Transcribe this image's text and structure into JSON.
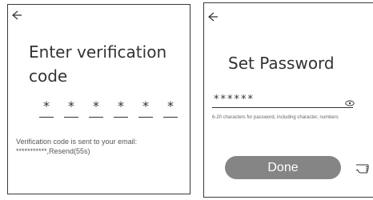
{
  "verify_screen": {
    "back_icon": "arrow-left-icon",
    "title": "Enter verification code",
    "code_chars": [
      "*",
      "*",
      "*",
      "*",
      "*",
      "*"
    ],
    "info_line1": "Verification code is sent to your email:",
    "info_line2": "***********,Resend(55s)"
  },
  "password_screen": {
    "back_icon": "arrow-left-icon",
    "title": "Set Password",
    "password_value": "******",
    "eye_icon": "eye-icon",
    "hint": "6-20 characters for password, including character, numbers",
    "done_label": "Done",
    "pointer_icon": "hand-pointer-icon",
    "button_color": "#858585"
  }
}
